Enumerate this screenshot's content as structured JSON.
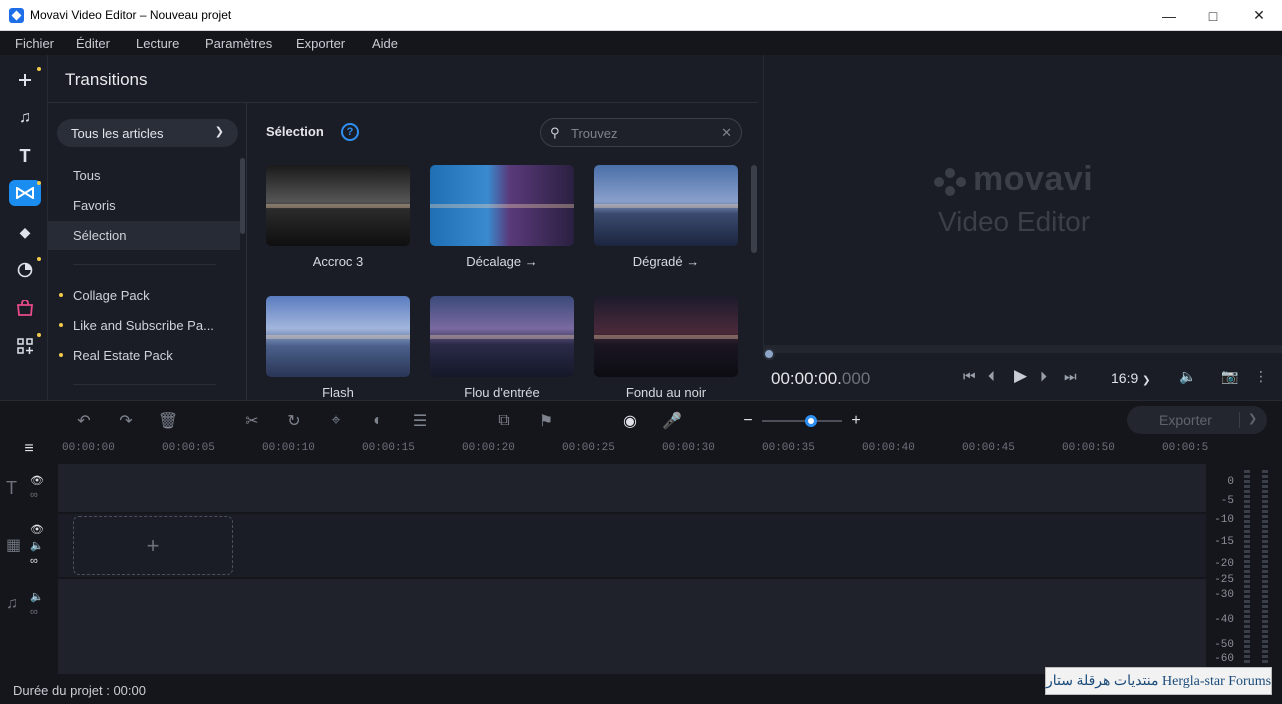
{
  "window": {
    "title": "Movavi Video Editor – Nouveau projet"
  },
  "menu": {
    "items": [
      "Fichier",
      "Éditer",
      "Lecture",
      "Paramètres",
      "Exporter",
      "Aide"
    ]
  },
  "sidebar": {
    "icons": [
      "add-media-icon",
      "music-icon",
      "titles-icon",
      "transitions-icon",
      "stickers-icon",
      "filters-icon",
      "store-icon",
      "more-tools-icon"
    ]
  },
  "panel": {
    "title": "Transitions",
    "category_dropdown": "Tous les articles",
    "categories": [
      "Tous",
      "Favoris",
      "Sélection"
    ],
    "selected_category": "Sélection",
    "packs": [
      "Collage Pack",
      "Like and Subscribe Pa...",
      "Real Estate Pack"
    ],
    "section_title": "Sélection",
    "help": "?",
    "search_placeholder": "Trouvez",
    "items": [
      {
        "label": "Accroc 3"
      },
      {
        "label": "Décalage →"
      },
      {
        "label": "Dégradé →"
      },
      {
        "label": "Flash"
      },
      {
        "label": "Flou d'entrée"
      },
      {
        "label": "Fondu au noir"
      }
    ]
  },
  "preview": {
    "brand": "movavi",
    "brand_sub": "Video Editor",
    "timecode_main": "00:00:00.",
    "timecode_ms": "000",
    "aspect_ratio": "16:9",
    "playback_progress": 0
  },
  "timeline": {
    "zoom_level": 0.55,
    "export_label": "Exporter",
    "ruler": [
      "00:00:00",
      "00:00:05",
      "00:00:10",
      "00:00:15",
      "00:00:20",
      "00:00:25",
      "00:00:30",
      "00:00:35",
      "00:00:40",
      "00:00:45",
      "00:00:50",
      "00:00:5"
    ],
    "meter_labels": [
      "0",
      "-5",
      "-10",
      "-15",
      "-20",
      "-25",
      "-30",
      "-40",
      "-50",
      "-60"
    ],
    "drop_zone": "+"
  },
  "status": {
    "duration": "Durée du projet : 00:00"
  },
  "watermark": "منتديات هرقلة ستار Hergla-star Forums",
  "colors": {
    "accent": "#1b8cf0",
    "background": "#1a1d25",
    "panel_selected": "#272b36",
    "pack_dot": "#f2c94c"
  }
}
